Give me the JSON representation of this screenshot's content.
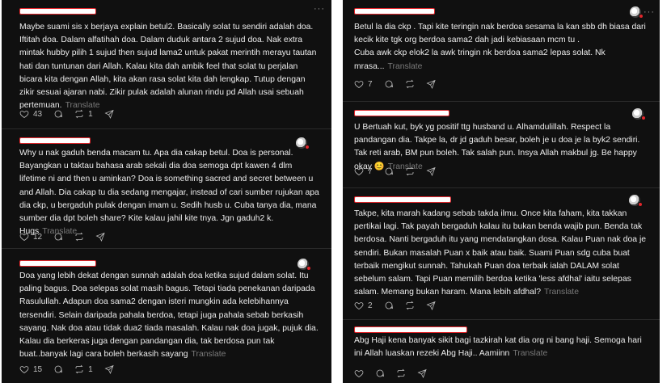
{
  "translate_label": "Translate",
  "left_column": [
    {
      "text": "Maybe suami sis x berjaya explain betul2. Basically solat tu sendiri adalah doa. Iftitah doa. Dalam alfatihah doa. Dalam duduk antara 2 sujud doa. Nak extra mintak hubby pilih 1 sujud then sujud lama2 untuk pakat merintih merayu tautan hati dan tuntunan dari Allah. Kalau kita dah ambik feel that solat tu perjalan bicara kita dengan Allah, kita akan rasa solat kita dah lengkap. Tutup dengan zikir sesuai ajaran nabi. Zikir pulak adalah alunan rindu pd Allah usai sebuah pertemuan.",
      "likes": "43",
      "reposts": "1"
    },
    {
      "text": "Why u nak gaduh benda macam tu. Apa dia cakap betul. Doa is personal. Bayangkan u taktau bahasa arab sekali dia doa semoga dpt kawen 4 dlm lifetime ni and then u aminkan? Doa is something sacred and secret between u and Allah. Dia cakap tu dia sedang mengajar, instead of cari sumber rujukan apa dia ckp, u bergaduh pulak dengan imam u. Sedih husb u. Cuba tanya dia, mana sumber dia dpt boleh share? Kite kalau jahil kite tnya. Jgn gaduh2 k. Hugs",
      "likes": "12"
    },
    {
      "text": "Doa yang lebih dekat dengan sunnah adalah doa ketika sujud dalam solat. Itu paling bagus. Doa selepas solat masih bagus. Tetapi tiada penekanan daripada Rasulullah. Adapun doa sama2 dengan isteri mungkin ada kelebihannya tersendiri. Selain daripada pahala berdoa, tetapi juga pahala sebab berkasih sayang. Nak doa atau tidak dua2 tiada masalah. Kalau nak doa jugak, pujuk dia. Kalau dia berkeras juga dengan pandangan dia, tak berdosa pun tak buat..banyak lagi cara boleh berkasih sayang",
      "likes": "15",
      "reposts": "1"
    }
  ],
  "right_column": [
    {
      "text": "Betul la dia ckp . Tapi kite teringin nak berdoa sesama la kan sbb dh biasa dari kecik kite tgk org berdoa sama2 dah jadi kebiasaan mcm tu .\nCuba awk ckp elok2 la awk tringin nk berdoa sama2 lepas solat. Nk mrasa...",
      "likes": "7"
    },
    {
      "text": "U Bertuah kut, byk yg positif ttg husband u. Alhamdulillah. Respect la pandangan dia. Takpe la, dr jd gaduh besar, boleh je u doa je la byk2 sendiri. Tak reti arab, BM pun boleh. Tak salah pun. Insya Allah makbul jg. Be happy okay",
      "emoji": "😊",
      "likes": "7"
    },
    {
      "text": "Takpe, kita marah kadang sebab takda ilmu. Once kita faham, kita takkan pertikai lagi. Tak payah bergaduh kalau itu bukan benda wajib pun. Benda tak berdosa. Nanti bergaduh itu yang mendatangkan dosa. Kalau Puan nak doa je sendiri. Bukan masalah Puan x baik atau baik. Suami Puan sdg cuba buat terbaik mengikut sunnah. Tahukah Puan doa terbaik ialah DALAM solat sebelum salam. Tapi Puan memilih berdoa ketika 'less afdhal' iaitu selepas salam. Memang bukan haram. Mana lebih afdhal?",
      "likes": "2"
    },
    {
      "text": "Abg Haji kena banyak sikit bagi tazkirah kat dia org ni bang haji. Semoga hari ini Allah luaskan rezeki Abg Haji.. Aamiinn"
    }
  ]
}
